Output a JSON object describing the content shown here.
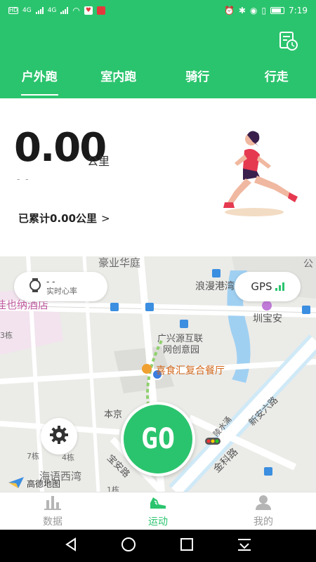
{
  "status_bar": {
    "left_indicators": [
      "HD",
      "4G",
      "4G"
    ],
    "time": "7:19"
  },
  "header": {
    "history_icon": "records-clock-icon",
    "tabs": [
      {
        "label": "户外跑",
        "active": true
      },
      {
        "label": "室内跑",
        "active": false
      },
      {
        "label": "骑行",
        "active": false
      },
      {
        "label": "行走",
        "active": false
      }
    ]
  },
  "summary": {
    "distance": "0.00",
    "unit": "公里",
    "sub_value": "- -",
    "cumulative": "已累计0.00公里",
    "chevron": ">"
  },
  "map": {
    "heart_rate_value": "- -",
    "heart_rate_label": "实时心率",
    "gps_label": "GPS",
    "go_label": "GO",
    "amap_label": "高德地图",
    "labels": {
      "l1": "豪业华庭",
      "l2": "浪漫港湾",
      "l3": "佳也纳酒店",
      "l4": "圳宝安",
      "l5": "广兴源互联",
      "l6": "网创意园",
      "l7": "喜食汇复合餐厅",
      "l8": "本京",
      "l9": "新安六路",
      "l10": "宝安路",
      "l11": "金科路",
      "l12": "海语西湾",
      "l13": "7栋",
      "l14": "4栋",
      "l15": "1栋",
      "l16": "3栋",
      "l17": "公",
      "l18": "陵水涌"
    }
  },
  "bottom_nav": [
    {
      "label": "数据",
      "icon": "bar-chart-icon",
      "active": false
    },
    {
      "label": "运动",
      "icon": "running-shoe-icon",
      "active": true
    },
    {
      "label": "我的",
      "icon": "user-icon",
      "active": false
    }
  ],
  "colors": {
    "brand_green": "#2bc46e",
    "text_dark": "#1a1a1a",
    "inactive": "#9a9a9a"
  }
}
